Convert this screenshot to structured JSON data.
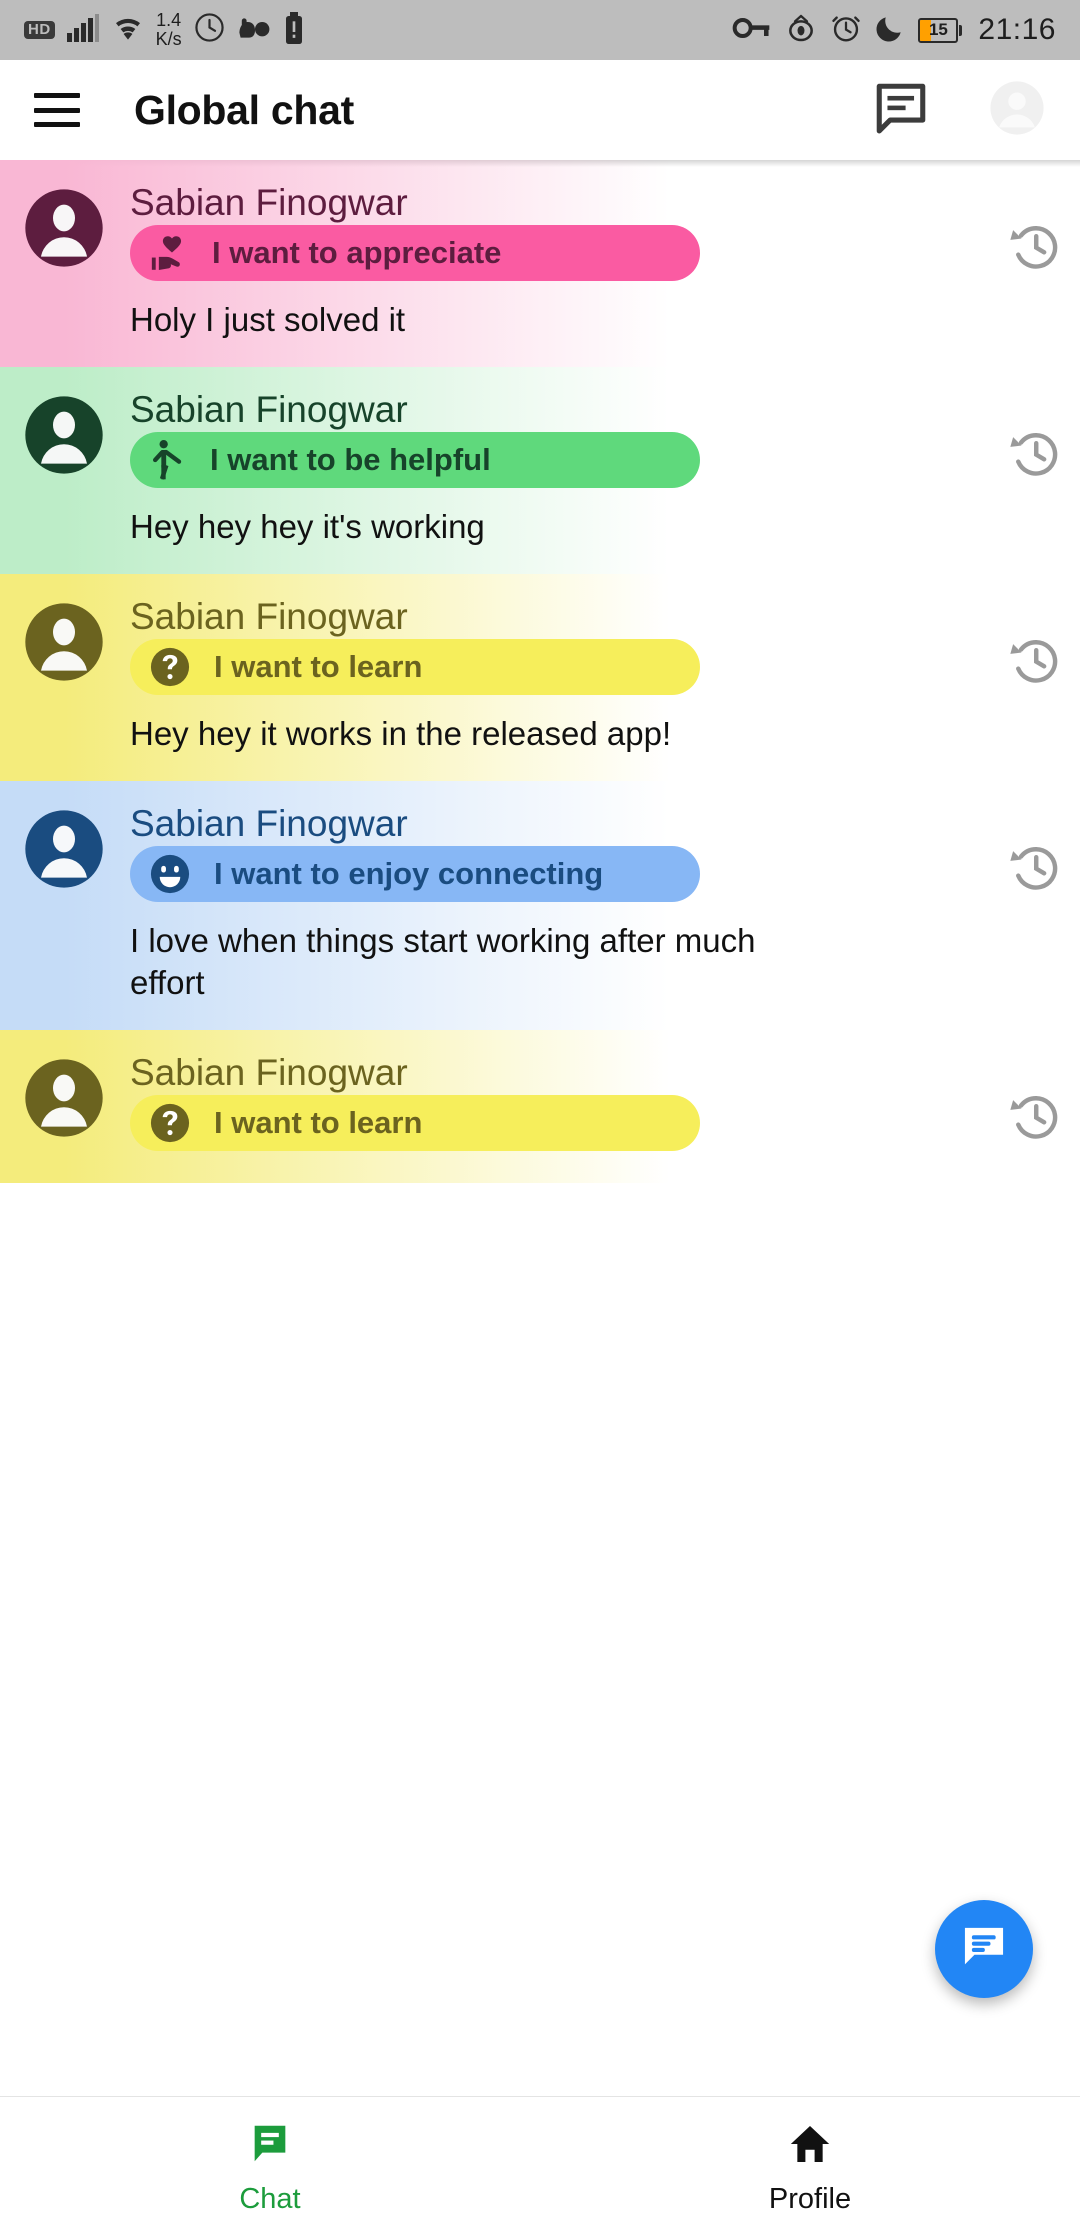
{
  "status_bar": {
    "hd_badge": "HD",
    "network_rate_value": "1.4",
    "network_rate_unit": "K/s",
    "battery_level": "15",
    "time": "21:16",
    "left_icons": [
      "hd-badge-icon",
      "signal-bars-icon",
      "wifi-icon",
      "network-speed-icon",
      "clock-icon",
      "do-not-disturb-icon",
      "battery-alert-icon"
    ],
    "right_icons": [
      "vpn-key-icon",
      "eye-icon",
      "alarm-clock-icon",
      "moon-icon",
      "battery-icon"
    ]
  },
  "app_bar": {
    "title": "Global chat",
    "menu_icon": "hamburger-menu-icon",
    "chat_icon": "chat-bubble-icon",
    "avatar_icon": "account-circle-icon"
  },
  "colors": {
    "appreciate_pill": "#fa5ba2",
    "appreciate_tint": "#f9b7d4",
    "appreciate_text": "#5d1d3f",
    "helpful_pill": "#5fd97c",
    "helpful_tint": "#bdedc8",
    "helpful_text": "#17432a",
    "learn_pill": "#f6ee5b",
    "learn_tint": "#f4ec7c",
    "learn_text": "#6b631f",
    "connect_pill": "#87b7f5",
    "connect_tint": "#c5dcf7",
    "connect_text": "#1a4c80",
    "fab": "#2286f5",
    "nav_active": "#1c9c3c"
  },
  "messages": [
    {
      "author": "Sabian Finogwar",
      "intent": "I want to appreciate",
      "intent_icon": "volunteer-activism-icon",
      "text": "Holy I just solved it",
      "theme": "appreciate",
      "history_icon": "history-icon"
    },
    {
      "author": "Sabian Finogwar",
      "intent": "I want to be helpful",
      "intent_icon": "person-raising-hand-icon",
      "text": "Hey hey hey it's working",
      "theme": "helpful",
      "history_icon": "history-icon"
    },
    {
      "author": "Sabian Finogwar",
      "intent": "I want to learn",
      "intent_icon": "help-circle-icon",
      "text": "Hey hey it works in the released app!",
      "theme": "learn",
      "history_icon": "history-icon"
    },
    {
      "author": "Sabian Finogwar",
      "intent": "I want to enjoy connecting",
      "intent_icon": "smiley-face-icon",
      "text": "I love when things start working after much effort",
      "theme": "connect",
      "history_icon": "history-icon"
    },
    {
      "author": "Sabian Finogwar",
      "intent": "I want to learn",
      "intent_icon": "help-circle-icon",
      "text": "",
      "theme": "learn",
      "history_icon": "history-icon"
    }
  ],
  "fab": {
    "icon": "chat-bubble-icon"
  },
  "bottom_nav": {
    "items": [
      {
        "label": "Chat",
        "icon": "chat-bubble-icon",
        "active": true
      },
      {
        "label": "Profile",
        "icon": "home-icon",
        "active": false
      }
    ]
  }
}
